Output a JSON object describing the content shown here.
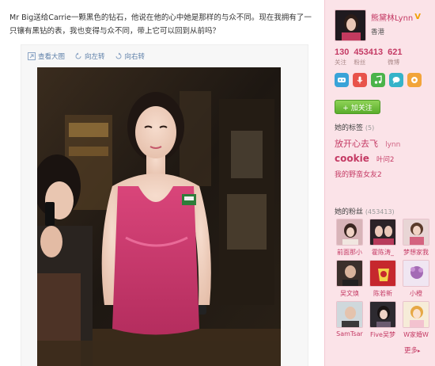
{
  "post": {
    "text": "Mr Big送给Carrie一颗黑色的钻石，他说在他的心中她是那样的与众不同。现在我拥有了一只镶有黑钻的表，我也变得与众不同，带上它可以回到从前吗？"
  },
  "toolbar": {
    "view_large": "查看大图",
    "rotate_left": "向左转",
    "rotate_right": "向右转"
  },
  "profile": {
    "name": "熊黛林Lynn",
    "verified_badge": "V",
    "location": "香港",
    "stats": [
      {
        "value": "130",
        "label": "关注"
      },
      {
        "value": "453413",
        "label": "粉丝"
      },
      {
        "value": "621",
        "label": "微博"
      }
    ],
    "follow_label": "+ 加关注"
  },
  "tags": {
    "title": "她的标签",
    "count": "(5)",
    "items": [
      "放开心去飞",
      "lynn",
      "cookie",
      "叶问2",
      "我的野蛮女友2"
    ]
  },
  "fans": {
    "title": "她的粉丝",
    "count": "(453413)",
    "items": [
      {
        "name": "前面那小"
      },
      {
        "name": "霍陈涛_"
      },
      {
        "name": "梦想家我"
      },
      {
        "name": "吴文焕"
      },
      {
        "name": "陈若新"
      },
      {
        "name": "小橙"
      },
      {
        "name": "SamTsar"
      },
      {
        "name": "Five吴梦"
      },
      {
        "name": "W家婚W"
      }
    ],
    "more_label": "更多"
  },
  "colors": {
    "accent_pink": "#c43a64",
    "sidebar_bg": "#fbe3e8",
    "link_blue": "#5d7fa8",
    "follow_green": "#5aad2b"
  }
}
